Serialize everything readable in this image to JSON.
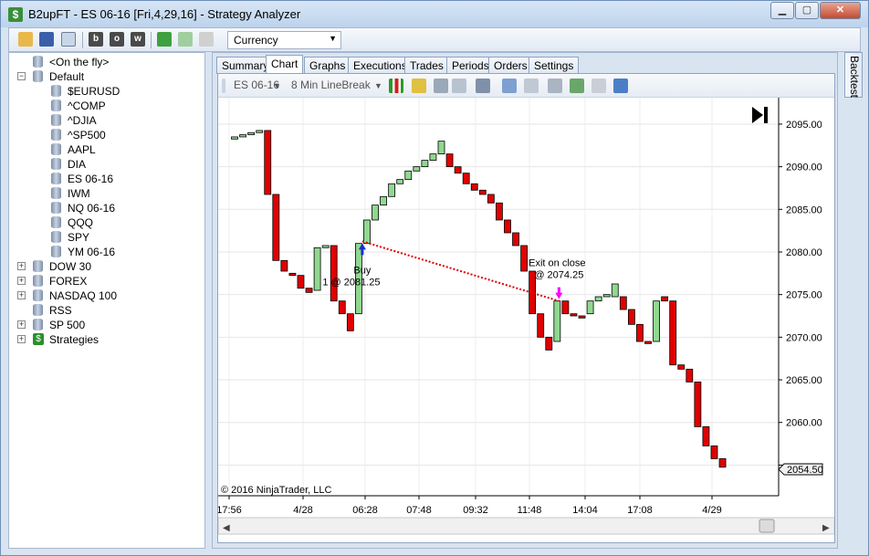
{
  "window": {
    "title": "B2upFT - ES 06-16 [Fri,4,29,16] - Strategy Analyzer"
  },
  "window_buttons": {
    "minimize": "▁",
    "maximize": "▢",
    "close": "✕"
  },
  "toolbar": {
    "currency": "Currency",
    "letters": [
      "b",
      "o",
      "w"
    ]
  },
  "tree": {
    "items": [
      {
        "label": "<On the fly>",
        "level": 1,
        "expand": "",
        "icon": "database-icon"
      },
      {
        "label": "Default",
        "level": 0,
        "expand": "−",
        "icon": "database-icon"
      },
      {
        "label": "$EURUSD",
        "level": 2,
        "expand": "",
        "icon": "database-icon"
      },
      {
        "label": "^COMP",
        "level": 2,
        "expand": "",
        "icon": "database-icon"
      },
      {
        "label": "^DJIA",
        "level": 2,
        "expand": "",
        "icon": "database-icon"
      },
      {
        "label": "^SP500",
        "level": 2,
        "expand": "",
        "icon": "database-icon"
      },
      {
        "label": "AAPL",
        "level": 2,
        "expand": "",
        "icon": "database-icon"
      },
      {
        "label": "DIA",
        "level": 2,
        "expand": "",
        "icon": "database-icon"
      },
      {
        "label": "ES 06-16",
        "level": 2,
        "expand": "",
        "icon": "database-icon"
      },
      {
        "label": "IWM",
        "level": 2,
        "expand": "",
        "icon": "database-icon"
      },
      {
        "label": "NQ 06-16",
        "level": 2,
        "expand": "",
        "icon": "database-icon"
      },
      {
        "label": "QQQ",
        "level": 2,
        "expand": "",
        "icon": "database-icon"
      },
      {
        "label": "SPY",
        "level": 2,
        "expand": "",
        "icon": "database-icon"
      },
      {
        "label": "YM 06-16",
        "level": 2,
        "expand": "",
        "icon": "database-icon"
      },
      {
        "label": "DOW 30",
        "level": 0,
        "expand": "+",
        "icon": "database-icon"
      },
      {
        "label": "FOREX",
        "level": 0,
        "expand": "+",
        "icon": "database-icon"
      },
      {
        "label": "NASDAQ 100",
        "level": 0,
        "expand": "+",
        "icon": "database-icon"
      },
      {
        "label": "RSS",
        "level": 0,
        "expand": "",
        "icon": "database-icon"
      },
      {
        "label": "SP 500",
        "level": 0,
        "expand": "+",
        "icon": "database-icon"
      },
      {
        "label": "Strategies",
        "level": 0,
        "expand": "+",
        "icon": "strategy-icon"
      }
    ]
  },
  "tabs": [
    "Summary",
    "Chart",
    "Graphs",
    "Executions",
    "Trades",
    "Periods",
    "Orders",
    "Settings"
  ],
  "active_tab": "Chart",
  "side_tab": "Backtest",
  "chart_toolbar": {
    "instrument": "ES 06-16",
    "period": "8 Min LineBreak"
  },
  "chart_data": {
    "type": "candlestick",
    "copyright": "© 2016 NinjaTrader, LLC",
    "x_labels": [
      "17:56",
      "4/28",
      "06:28",
      "07:48",
      "09:32",
      "11:48",
      "14:04",
      "17:08",
      "4/29"
    ],
    "y_ticks": [
      "2095.00",
      "2090.00",
      "2085.00",
      "2080.00",
      "2075.00",
      "2070.00",
      "2065.00",
      "2060.00",
      "2055.00"
    ],
    "ylim": [
      2051.4,
      2098.1
    ],
    "last_price": "2054.50",
    "colors": {
      "up": "#90d890",
      "down": "#e00000",
      "trade_line": "#e00000",
      "buy": "#1a2fd0",
      "exit": "#ff00ff"
    },
    "bars": [
      {
        "o": 2093.25,
        "c": 2093.5
      },
      {
        "o": 2093.5,
        "c": 2093.75
      },
      {
        "o": 2093.75,
        "c": 2094.0
      },
      {
        "o": 2094.0,
        "c": 2094.25
      },
      {
        "o": 2094.25,
        "c": 2086.75
      },
      {
        "o": 2086.75,
        "c": 2079.0
      },
      {
        "o": 2079.0,
        "c": 2077.75
      },
      {
        "o": 2077.5,
        "c": 2077.25
      },
      {
        "o": 2077.25,
        "c": 2075.75
      },
      {
        "o": 2075.75,
        "c": 2075.25
      },
      {
        "o": 2075.5,
        "c": 2080.5
      },
      {
        "o": 2080.5,
        "c": 2080.75
      },
      {
        "o": 2080.75,
        "c": 2074.25
      },
      {
        "o": 2074.25,
        "c": 2072.75
      },
      {
        "o": 2072.75,
        "c": 2070.75
      },
      {
        "o": 2072.75,
        "c": 2081.0
      },
      {
        "o": 2081.0,
        "c": 2083.75
      },
      {
        "o": 2083.75,
        "c": 2085.5
      },
      {
        "o": 2085.5,
        "c": 2086.5
      },
      {
        "o": 2086.5,
        "c": 2088.0
      },
      {
        "o": 2088.0,
        "c": 2088.5
      },
      {
        "o": 2088.5,
        "c": 2089.5
      },
      {
        "o": 2089.5,
        "c": 2090.0
      },
      {
        "o": 2090.0,
        "c": 2090.75
      },
      {
        "o": 2090.75,
        "c": 2091.5
      },
      {
        "o": 2091.5,
        "c": 2093.0
      },
      {
        "o": 2091.5,
        "c": 2090.0
      },
      {
        "o": 2090.0,
        "c": 2089.25
      },
      {
        "o": 2089.25,
        "c": 2088.0
      },
      {
        "o": 2088.0,
        "c": 2087.25
      },
      {
        "o": 2087.25,
        "c": 2086.75
      },
      {
        "o": 2086.75,
        "c": 2085.75
      },
      {
        "o": 2085.75,
        "c": 2083.75
      },
      {
        "o": 2083.75,
        "c": 2082.25
      },
      {
        "o": 2082.25,
        "c": 2080.75
      },
      {
        "o": 2080.75,
        "c": 2077.75
      },
      {
        "o": 2077.75,
        "c": 2072.75
      },
      {
        "o": 2072.75,
        "c": 2070.0
      },
      {
        "o": 2070.0,
        "c": 2068.5
      },
      {
        "o": 2069.5,
        "c": 2074.25
      },
      {
        "o": 2074.25,
        "c": 2072.75
      },
      {
        "o": 2072.75,
        "c": 2072.5
      },
      {
        "o": 2072.5,
        "c": 2072.25
      },
      {
        "o": 2072.75,
        "c": 2074.25
      },
      {
        "o": 2074.25,
        "c": 2074.75
      },
      {
        "o": 2074.75,
        "c": 2075.0
      },
      {
        "o": 2074.75,
        "c": 2076.25
      },
      {
        "o": 2074.75,
        "c": 2073.25
      },
      {
        "o": 2073.25,
        "c": 2071.5
      },
      {
        "o": 2071.5,
        "c": 2069.5
      },
      {
        "o": 2069.5,
        "c": 2069.25
      },
      {
        "o": 2069.5,
        "c": 2074.25
      },
      {
        "o": 2074.75,
        "c": 2074.25
      },
      {
        "o": 2074.25,
        "c": 2066.75
      },
      {
        "o": 2066.75,
        "c": 2066.25
      },
      {
        "o": 2066.25,
        "c": 2064.75
      },
      {
        "o": 2064.75,
        "c": 2059.5
      },
      {
        "o": 2059.5,
        "c": 2057.25
      },
      {
        "o": 2057.25,
        "c": 2055.75
      },
      {
        "o": 2055.75,
        "c": 2054.75
      }
    ],
    "trade": {
      "entry_bar": 15,
      "entry_price": 2081.25,
      "entry_label": "Buy",
      "entry_detail": "1 @ 2081.25",
      "exit_bar": 39,
      "exit_price": 2074.25,
      "exit_label": "Exit on close",
      "exit_detail": "@ 2074.25"
    }
  }
}
